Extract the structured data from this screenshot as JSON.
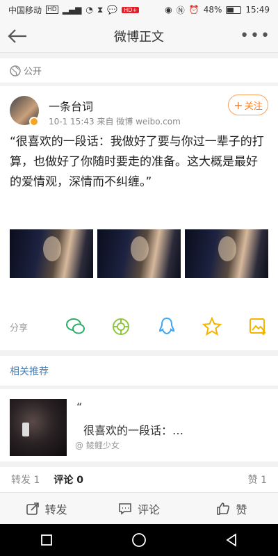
{
  "status": {
    "carrier": "中国移动",
    "hd": "HD",
    "net_badge": "HD+",
    "battery": "48%",
    "time": "15:49",
    "battery_level": 0.48
  },
  "nav": {
    "title": "微博正文"
  },
  "visibility": {
    "label": "公开"
  },
  "post": {
    "username": "一条台词",
    "meta": "10-1 15:43  来自 微博 weibo.com",
    "follow_label": "关注",
    "text": "“很喜欢的一段话：我做好了要与你过一辈子的打算，也做好了你随时要走的准备。这大概是最好的爱情观，深情而不纠缠。”",
    "share_label": "分享"
  },
  "related": {
    "heading": "相关推荐",
    "quote_mark": "“",
    "title": "很喜欢的一段话：…",
    "author": "@ 鲮鲤少女"
  },
  "counts": {
    "repost": "转发 1",
    "comment": "评论 0",
    "like": "赞 1"
  },
  "actions": {
    "repost": "转发",
    "comment": "评论",
    "like": "赞"
  },
  "colors": {
    "accent": "#ff7d1a",
    "link": "#4a7fb5",
    "wechat": "#2aae67",
    "moments": "#8dc63f",
    "qq": "#3ea5f0",
    "qzone": "#f5b400"
  }
}
